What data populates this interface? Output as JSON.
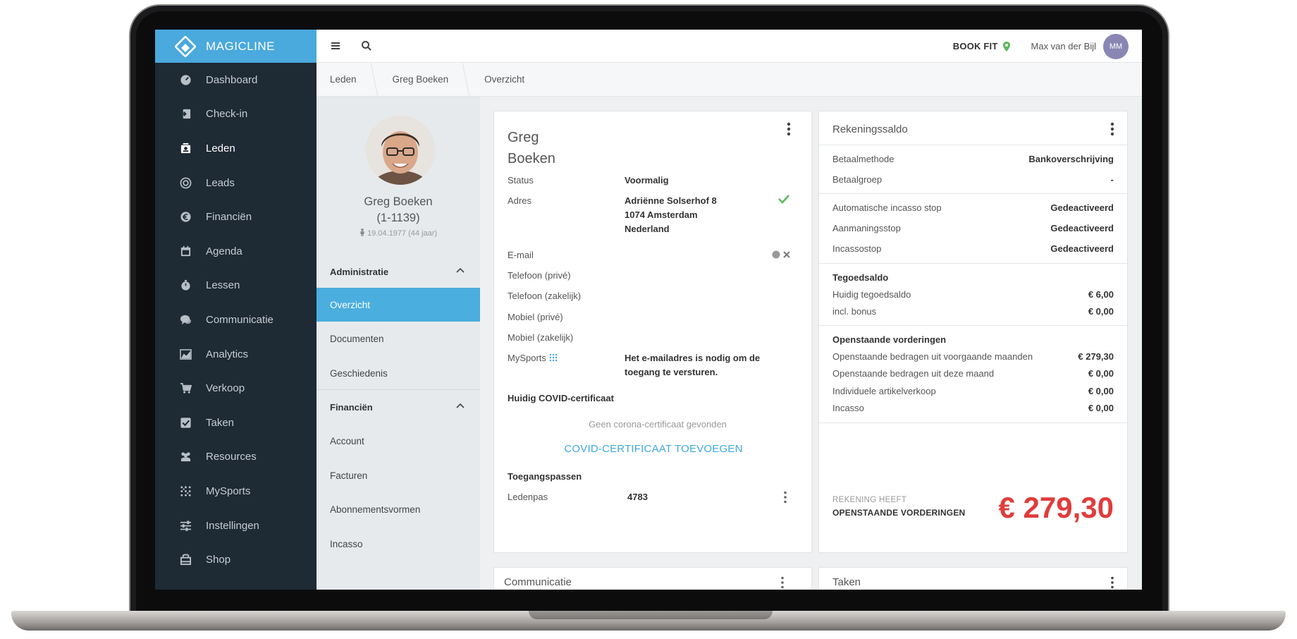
{
  "brand": {
    "name": "MAGICLINE"
  },
  "sidebar": {
    "items": [
      {
        "label": "Dashboard",
        "icon": "dashboard-icon"
      },
      {
        "label": "Check-in",
        "icon": "check-in-icon"
      },
      {
        "label": "Leden",
        "icon": "members-icon",
        "active": true
      },
      {
        "label": "Leads",
        "icon": "leads-icon"
      },
      {
        "label": "Financiën",
        "icon": "euro-icon"
      },
      {
        "label": "Agenda",
        "icon": "calendar-icon"
      },
      {
        "label": "Lessen",
        "icon": "stopwatch-icon"
      },
      {
        "label": "Communicatie",
        "icon": "chat-icon"
      },
      {
        "label": "Analytics",
        "icon": "chart-icon"
      },
      {
        "label": "Verkoop",
        "icon": "cart-icon"
      },
      {
        "label": "Taken",
        "icon": "checkbox-icon"
      },
      {
        "label": "Resources",
        "icon": "people-icon"
      },
      {
        "label": "MySports",
        "icon": "dots-grid-icon"
      },
      {
        "label": "Instellingen",
        "icon": "sliders-icon"
      },
      {
        "label": "Shop",
        "icon": "shop-icon"
      }
    ]
  },
  "topbar": {
    "studio": "BOOK FIT",
    "user": "Max van der Bijl",
    "user_initials": "MM"
  },
  "breadcrumb": [
    "Leden",
    "Greg Boeken",
    "Overzicht"
  ],
  "member": {
    "name": "Greg Boeken",
    "id": "(1-1139)",
    "dob": "19.04.1977 (44 jaar)",
    "sections": [
      {
        "title": "Administratie",
        "links": [
          "Overzicht",
          "Documenten",
          "Geschiedenis"
        ]
      },
      {
        "title": "Financiën",
        "links": [
          "Account",
          "Facturen",
          "Abonnementsvormen",
          "Incasso"
        ]
      }
    ]
  },
  "profile": {
    "first_name": "Greg",
    "last_name": "Boeken",
    "rows": [
      {
        "label": "Status",
        "value": "Voormalig"
      },
      {
        "label": "Adres",
        "value_lines": [
          "Adriënne Solserhof 8",
          "1074 Amsterdam",
          "Nederland"
        ]
      },
      {
        "label": "E-mail",
        "value": ""
      },
      {
        "label": "Telefoon (privé)",
        "value": ""
      },
      {
        "label": "Telefoon (zakelijk)",
        "value": ""
      },
      {
        "label": "Mobiel (privé)",
        "value": ""
      },
      {
        "label": "Mobiel (zakelijk)",
        "value": ""
      },
      {
        "label": "MySports",
        "value_lines": [
          "Het e-mailadres is nodig om de",
          "toegang te versturen."
        ]
      }
    ],
    "covid_heading": "Huidig COVID-certificaat",
    "covid_empty": "Geen corona-certificaat gevonden",
    "covid_add": "COVID-CERTIFICAAT TOEVOEGEN",
    "access_heading": "Toegangspassen",
    "access_label": "Ledenpas",
    "access_value": "4783"
  },
  "balance": {
    "title": "Rekeningssaldo",
    "group1": [
      {
        "label": "Betaalmethode",
        "value": "Bankoverschrijving"
      },
      {
        "label": "Betaalgroep",
        "value": "-"
      }
    ],
    "group2": [
      {
        "label": "Automatische incasso stop",
        "value": "Gedeactiveerd"
      },
      {
        "label": "Aanmaningsstop",
        "value": "Gedeactiveerd"
      },
      {
        "label": "Incassostop",
        "value": "Gedeactiveerd"
      }
    ],
    "credit_heading": "Tegoedsaldo",
    "credit": [
      {
        "label": "Huidig tegoedsaldo",
        "value": "€ 6,00"
      },
      {
        "label": "incl. bonus",
        "value": "€ 0,00"
      }
    ],
    "open_heading": "Openstaande vorderingen",
    "open": [
      {
        "label": "Openstaande bedragen uit voorgaande maanden",
        "value": "€ 279,30"
      },
      {
        "label": "Openstaande bedragen uit deze maand",
        "value": "€ 0,00"
      },
      {
        "label": "Individuele artikelverkoop",
        "value": "€ 0,00"
      },
      {
        "label": "Incasso",
        "value": "€ 0,00"
      }
    ],
    "summary_caption1": "REKENING HEEFT",
    "summary_caption2": "OPENSTAANDE VORDERINGEN",
    "summary_amount": "€ 279,30",
    "colors": {
      "accent": "#4aa9dd",
      "alert": "#e03c3c",
      "ok": "#5cb85c"
    }
  },
  "bottom_cards": {
    "left_title": "Communicatie",
    "right_title": "Taken"
  }
}
